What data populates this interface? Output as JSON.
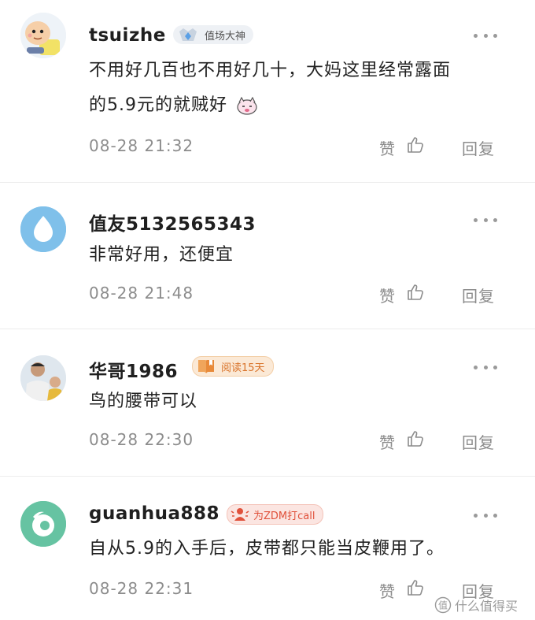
{
  "comments": [
    {
      "username": "tsuizhe",
      "badge": "值场大神",
      "body_lines": [
        "不用好几百也不用好几十，大妈这里经常露面",
        "的5.9元的就贼好"
      ],
      "time": "08-28 21:32",
      "like_label": "赞",
      "reply_label": "回复"
    },
    {
      "username": "值友5132565343",
      "badge": "",
      "body_lines": [
        "非常好用，还便宜"
      ],
      "time": "08-28 21:48",
      "like_label": "赞",
      "reply_label": "回复"
    },
    {
      "username": "华哥1986",
      "badge": "阅读15天",
      "body_lines": [
        "鸟的腰带可以"
      ],
      "time": "08-28 22:30",
      "like_label": "赞",
      "reply_label": "回复"
    },
    {
      "username": "guanhua888",
      "badge": "为ZDM打call",
      "body_lines": [
        "自从5.9的入手后，皮带都只能当皮鞭用了。"
      ],
      "time": "08-28 22:31",
      "like_label": "赞",
      "reply_label": "回复"
    }
  ],
  "watermark": "什么值得买",
  "colors": {
    "badge_blue_bg": "#eef1f5",
    "badge_orange_bg": "#fbe9d6",
    "badge_orange_text": "#d9732a",
    "badge_red_bg": "#fbe5e1",
    "badge_red_text": "#e0513b",
    "avatar_blue": "#7fc0ea",
    "avatar_green": "#66c3a2"
  }
}
